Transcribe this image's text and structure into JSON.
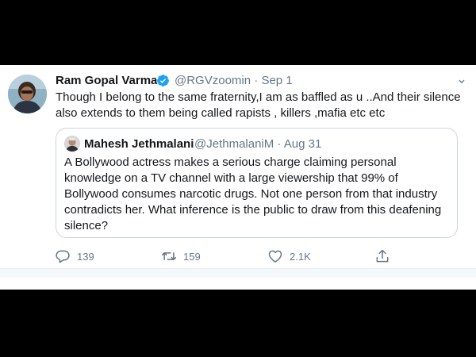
{
  "tweet": {
    "author_name": "Ram Gopal Varma",
    "handle": "@RGVzoomin",
    "separator": "·",
    "date": "Sep 1",
    "text": "Though I belong to the same fraternity,I am as baffled as u ..And their silence also extends to them being called rapists , killers ,mafia etc etc",
    "verified_icon": "verified-badge-icon",
    "accent_color": "#1da1f2"
  },
  "quoted_tweet": {
    "author_name": "Mahesh Jethmalani",
    "handle": "@JethmalaniM",
    "separator": "·",
    "date": "Aug 31",
    "text": "A Bollywood actress makes a serious charge claiming personal knowledge on a TV channel with a large viewership that 99% of Bollywood consumes narcotic drugs. Not one person from that industry contradicts her. What inference is the public to draw from this deafening silence?"
  },
  "actions": {
    "reply_count": "139",
    "retweet_count": "159",
    "like_count": "2.1K",
    "reply_icon": "reply-icon",
    "retweet_icon": "retweet-icon",
    "like_icon": "heart-icon",
    "share_icon": "share-icon"
  }
}
